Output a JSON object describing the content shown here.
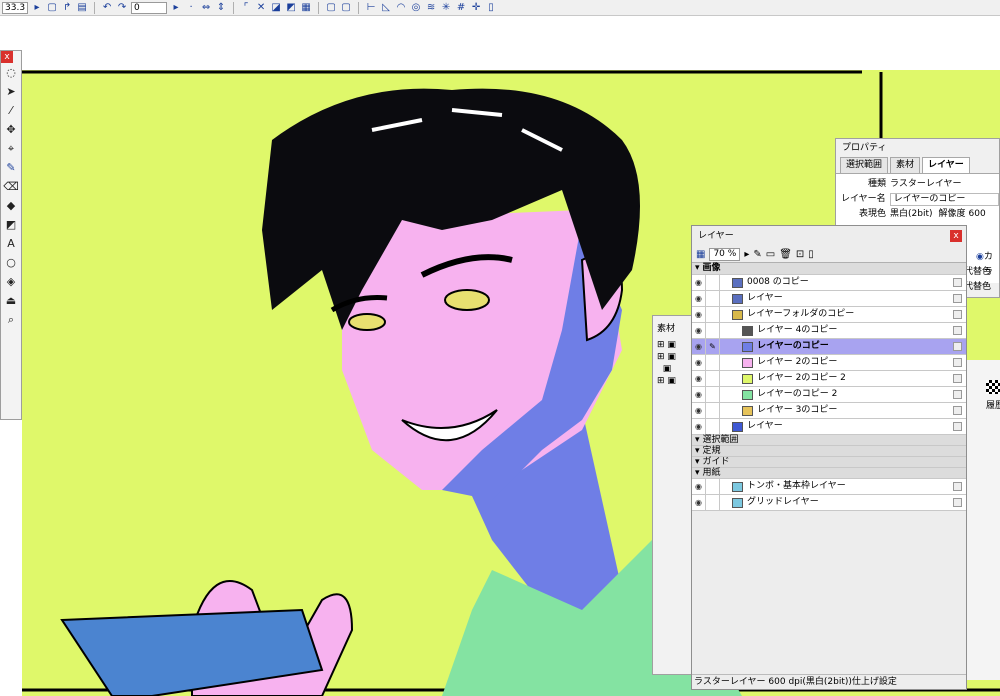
{
  "toolbar": {
    "zoom_value": "33.3",
    "angle_value": "0"
  },
  "colors": {
    "background_yellow": "#dff86a",
    "skin_pink": "#f7b2ef",
    "shadow_blue": "#6f7ee6",
    "shirt_green": "#84e3a2",
    "card_blue": "#4b84d0",
    "hair_black": "#0b0b0f",
    "eye_yellow": "#e8e070",
    "selected_row": "#a8a3f0"
  },
  "tools": [
    {
      "icon": "lasso-icon"
    },
    {
      "icon": "select-arrow-icon"
    },
    {
      "icon": "eyedropper-icon"
    },
    {
      "icon": "move-icon"
    },
    {
      "icon": "layer-move-icon"
    },
    {
      "icon": "pen-icon"
    },
    {
      "icon": "eraser-icon"
    },
    {
      "icon": "blend-icon"
    },
    {
      "icon": "fill-icon"
    },
    {
      "icon": "text-icon"
    },
    {
      "icon": "shape-icon"
    },
    {
      "icon": "paint-bucket-icon"
    },
    {
      "icon": "stamp-icon"
    },
    {
      "icon": "magnifier-icon"
    }
  ],
  "properties": {
    "title": "プロパティ",
    "tabs": [
      "選択範囲",
      "素材",
      "レイヤー"
    ],
    "kind_label": "種類",
    "kind_value": "ラスターレイヤー",
    "name_label": "レイヤー名",
    "name_value": "レイヤーのコピー",
    "color_label": "表現色",
    "color_value": "黒白(2bit)",
    "res_label": "解像度",
    "res_value": "600",
    "radio_label": "カラ",
    "tag1": "代替色",
    "tag2": "代替色"
  },
  "material": {
    "title": "素材"
  },
  "right_panel": {
    "label": "履歴"
  },
  "layers": {
    "title": "レイヤー",
    "zoom": "70 %",
    "rows": [
      {
        "name": "画像",
        "kind": "head"
      },
      {
        "name": "0008 のコピー",
        "kind": "layer",
        "indent": 0,
        "thumb": "#5a6fbf"
      },
      {
        "name": "レイヤー",
        "kind": "layer",
        "indent": 0,
        "thumb": "#5a6fbf"
      },
      {
        "name": "レイヤーフォルダのコピー",
        "kind": "folder",
        "indent": 0,
        "thumb": "#d8b94a"
      },
      {
        "name": "レイヤー 4のコピー",
        "kind": "layer",
        "indent": 1,
        "thumb": "#555555"
      },
      {
        "name": "レイヤーのコピー",
        "kind": "layer",
        "indent": 1,
        "thumb": "#6f7ee6",
        "selected": true
      },
      {
        "name": "レイヤー 2のコピー",
        "kind": "layer",
        "indent": 1,
        "thumb": "#f7b2ef"
      },
      {
        "name": "レイヤー 2のコピー 2",
        "kind": "layer",
        "indent": 1,
        "thumb": "#dff86a"
      },
      {
        "name": "レイヤーのコピー 2",
        "kind": "layer",
        "indent": 1,
        "thumb": "#84e3a2"
      },
      {
        "name": "レイヤー 3のコピー",
        "kind": "layer",
        "indent": 1,
        "thumb": "#e6c35a"
      },
      {
        "name": "レイヤー",
        "kind": "layer",
        "indent": 0,
        "thumb": "#3f59d4"
      },
      {
        "name": "選択範囲",
        "kind": "sub"
      },
      {
        "name": "定規",
        "kind": "sub"
      },
      {
        "name": "ガイド",
        "kind": "sub"
      },
      {
        "name": "用紙",
        "kind": "sub"
      },
      {
        "name": "トンボ・基本枠レイヤー",
        "kind": "layer",
        "indent": 0,
        "thumb": "#7cc8e0"
      },
      {
        "name": "グリッドレイヤー",
        "kind": "layer",
        "indent": 0,
        "thumb": "#7cc8e0"
      }
    ],
    "status": "ラスターレイヤー 600 dpi(黒白(2bit))仕上げ設定"
  }
}
